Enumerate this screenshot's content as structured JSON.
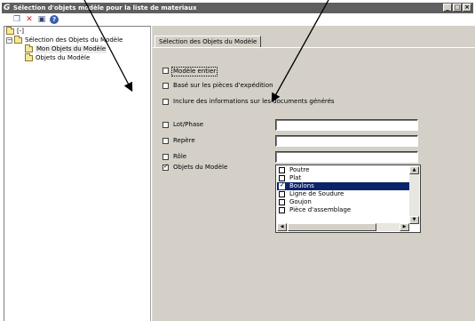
{
  "window": {
    "title": "Sélection d'objets modèle pour la liste de materiaux",
    "app_icon": "G"
  },
  "toolbar": {
    "icons": [
      "copy-icon",
      "delete-icon",
      "save-icon",
      "help-icon"
    ],
    "delete_glyph": "✕",
    "help_glyph": "?"
  },
  "tree": {
    "root_label": "[-]",
    "group_label": "Sélection des Objets du Modèle",
    "items": [
      {
        "label": "Mon Objets du Modèle",
        "selected": true
      },
      {
        "label": "Objets du Modèle",
        "selected": false
      }
    ]
  },
  "tab": {
    "label": "Sélection des Objets du Modèle"
  },
  "options": {
    "modele_entier": {
      "label": "Modèle entier",
      "checked": false
    },
    "base_pieces": {
      "label": "Basé sur les pièces d'expédition",
      "checked": false
    },
    "inclure_infos": {
      "label": "Inclure des informations sur les documents générés",
      "checked": false
    }
  },
  "filters": {
    "lot_phase": {
      "label": "Lot/Phase",
      "checked": false,
      "value": ""
    },
    "repere": {
      "label": "Repère",
      "checked": false,
      "value": ""
    },
    "role": {
      "label": "Rôle",
      "checked": false,
      "value": ""
    },
    "objets": {
      "label": "Objets du Modèle",
      "checked": true
    }
  },
  "object_list": [
    {
      "label": "Poutre",
      "checked": false,
      "highlighted": false
    },
    {
      "label": "Plat",
      "checked": false,
      "highlighted": false
    },
    {
      "label": "Boulons",
      "checked": true,
      "highlighted": true
    },
    {
      "label": "Ligne de Soudure",
      "checked": false,
      "highlighted": false
    },
    {
      "label": "Goujon",
      "checked": false,
      "highlighted": false
    },
    {
      "label": "Pièce d'assemblage",
      "checked": false,
      "highlighted": false
    }
  ],
  "colors": {
    "titlebar": "#5f5f5f",
    "panel": "#d4d0c8",
    "highlight": "#0a246a"
  }
}
